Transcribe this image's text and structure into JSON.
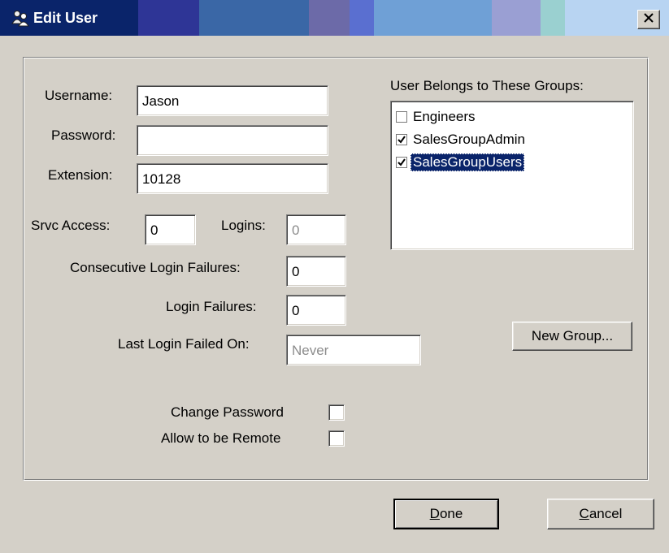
{
  "window": {
    "title": "Edit User",
    "close_symbol": "✕"
  },
  "colors": {
    "title_text": "#ffffff",
    "selection": "#0a246a",
    "face": "#d4d0c8"
  },
  "form": {
    "username_label": "Username:",
    "username_value": "Jason",
    "password_label": "Password:",
    "password_value": "",
    "extension_label": "Extension:",
    "extension_value": "10128",
    "srvc_access_label": "Srvc Access:",
    "srvc_access_value": "0",
    "logins_label": "Logins:",
    "logins_value": "0",
    "consecutive_failures_label": "Consecutive Login Failures:",
    "consecutive_failures_value": "0",
    "login_failures_label": "Login Failures:",
    "login_failures_value": "0",
    "last_failed_label": "Last Login Failed On:",
    "last_failed_value": "Never",
    "change_password_label": "Change Password",
    "change_password_checked": false,
    "allow_remote_label": "Allow to be Remote",
    "allow_remote_checked": false
  },
  "groups": {
    "label": "User Belongs to These Groups:",
    "items": [
      {
        "name": "Engineers",
        "checked": false,
        "selected": false
      },
      {
        "name": "SalesGroupAdmin",
        "checked": true,
        "selected": false
      },
      {
        "name": "SalesGroupUsers",
        "checked": true,
        "selected": true
      }
    ],
    "new_group_label": "New Group..."
  },
  "buttons": {
    "done_mnemonic": "D",
    "done_rest": "one",
    "cancel_mnemonic": "C",
    "cancel_rest": "ancel"
  }
}
